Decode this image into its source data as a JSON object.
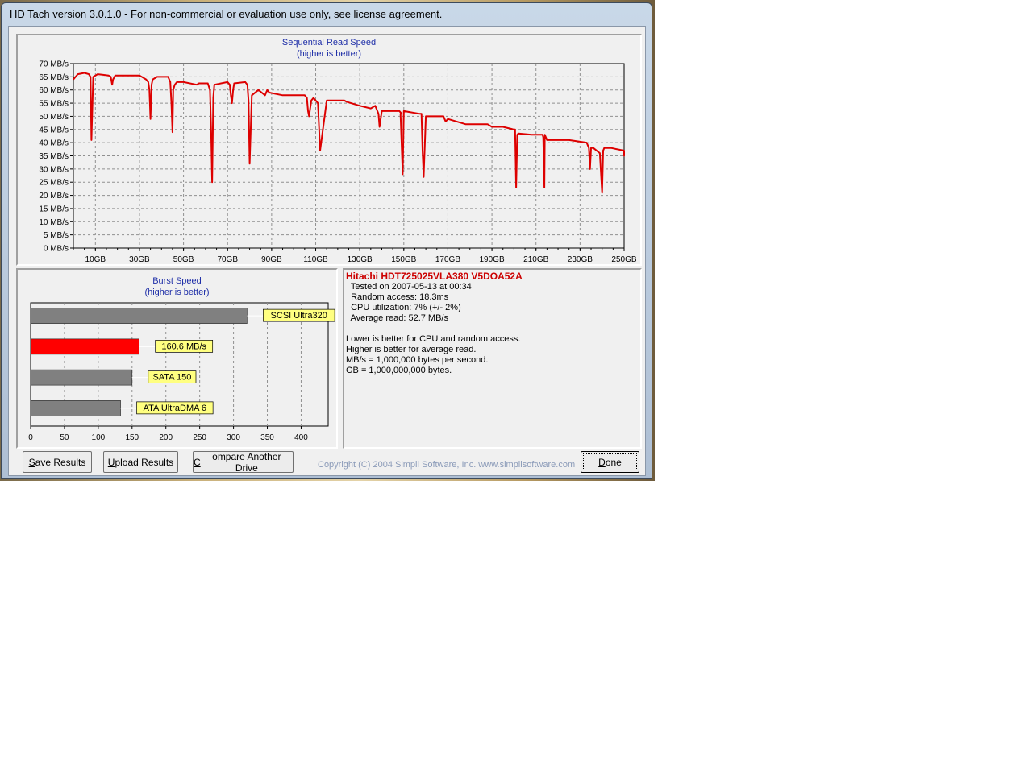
{
  "window": {
    "title": "HD Tach version 3.0.1.0  - For non-commercial or evaluation use only, see license agreement."
  },
  "colors": {
    "accent": "#dd0000",
    "title_blue": "#1f2fa8",
    "bar_gray": "#808080",
    "label_yellow": "#ffff80"
  },
  "sequential": {
    "title": "Sequential Read Speed",
    "subtitle": "(higher is better)"
  },
  "burst": {
    "title": "Burst Speed",
    "subtitle": "(higher is better)"
  },
  "chart_data": [
    {
      "type": "line",
      "title": "Sequential Read Speed",
      "subtitle": "(higher is better)",
      "xlabel": "",
      "ylabel": "",
      "x_unit": "GB",
      "y_unit": "MB/s",
      "xlim": [
        0,
        250
      ],
      "ylim": [
        0,
        70
      ],
      "grid": true,
      "x_ticks": [
        "10GB",
        "30GB",
        "50GB",
        "70GB",
        "90GB",
        "110GB",
        "130GB",
        "150GB",
        "170GB",
        "190GB",
        "210GB",
        "230GB",
        "250GB"
      ],
      "y_ticks": [
        "0 MB/s",
        "5 MB/s",
        "10 MB/s",
        "15 MB/s",
        "20 MB/s",
        "25 MB/s",
        "30 MB/s",
        "35 MB/s",
        "40 MB/s",
        "45 MB/s",
        "50 MB/s",
        "55 MB/s",
        "60 MB/s",
        "65 MB/s",
        "70 MB/s"
      ],
      "series": [
        {
          "color": "#dd0000",
          "x": [
            0,
            1,
            2,
            5,
            7,
            7.8,
            8.2,
            9,
            11,
            16,
            17,
            17.6,
            18,
            19,
            30,
            33,
            34,
            34.5,
            35,
            35.5,
            36,
            38,
            43,
            44,
            44.5,
            45,
            45.3,
            46,
            47,
            50,
            56,
            57,
            61,
            62,
            62.5,
            63,
            63.5,
            64,
            70,
            71,
            71.5,
            72,
            72.5,
            73,
            78,
            79,
            79.5,
            80,
            81,
            84,
            87,
            88,
            89,
            95,
            105,
            106,
            106.5,
            107,
            108,
            109,
            111,
            112,
            115,
            123,
            124,
            130,
            135,
            137,
            138.5,
            139,
            140,
            148,
            149,
            148.5,
            149.5,
            150,
            157,
            158,
            158.5,
            159,
            160,
            162,
            168,
            169,
            170,
            178,
            180,
            188,
            190,
            195,
            200,
            200.5,
            201,
            201.5,
            202,
            208,
            213,
            213.3,
            213.8,
            214,
            215,
            217,
            225,
            233,
            234,
            234.5,
            235,
            236,
            239,
            240,
            240.5,
            241,
            242,
            244,
            250,
            250.5,
            251
          ],
          "y": [
            64,
            65,
            66,
            66.5,
            66,
            65,
            41,
            65,
            66,
            65.5,
            65,
            62,
            64,
            65.5,
            65.5,
            64,
            63,
            60,
            49,
            62,
            64,
            65,
            65,
            63,
            55,
            44,
            60,
            62,
            63,
            63,
            62,
            62.5,
            62.5,
            60,
            45,
            25,
            57,
            62,
            63,
            62,
            58,
            55,
            60,
            62.5,
            63,
            62,
            56,
            32,
            58,
            60,
            58,
            60,
            59,
            58,
            58,
            57,
            52,
            50,
            56,
            57,
            55,
            37,
            56,
            56,
            55.5,
            54,
            53,
            54,
            51,
            46,
            52,
            52,
            51,
            51,
            28,
            52,
            51,
            51,
            37,
            27,
            50,
            50,
            50,
            48,
            49,
            47,
            47,
            47,
            46,
            46,
            45,
            45,
            23,
            43,
            43.5,
            43,
            43,
            42,
            23,
            43,
            41,
            41,
            41,
            40,
            38,
            30,
            38,
            38,
            36,
            21,
            37,
            38,
            38,
            38,
            37,
            35,
            36
          ],
          "annotations": []
        }
      ]
    },
    {
      "type": "bar",
      "orientation": "horizontal",
      "title": "Burst Speed",
      "subtitle": "(higher is better)",
      "xlim": [
        0,
        440
      ],
      "grid": true,
      "x_ticks": [
        "0",
        "50",
        "100",
        "150",
        "200",
        "250",
        "300",
        "350",
        "400"
      ],
      "categories": [
        "SCSI Ultra320",
        "160.6 MB/s",
        "SATA 150",
        "ATA UltraDMA 6"
      ],
      "values": [
        320,
        160.6,
        150,
        133
      ],
      "bar_colors": [
        "#808080",
        "#ff0000",
        "#808080",
        "#808080"
      ]
    }
  ],
  "info": {
    "drive": "Hitachi HDT725025VLA380 V5DOA52A",
    "tested": "  Tested on 2007-05-13 at 00:34",
    "random_access": "  Random access: 18.3ms",
    "cpu": "  CPU utilization: 7% (+/- 2%)",
    "average_read": "  Average read: 52.7 MB/s",
    "note1": "Lower is better for CPU and random access.",
    "note2": "Higher is better for average read.",
    "note3": "MB/s = 1,000,000 bytes per second.",
    "note4": "GB = 1,000,000,000 bytes."
  },
  "buttons": {
    "save": {
      "mnemonic": "S",
      "rest": "ave Results"
    },
    "upload": {
      "mnemonic": "U",
      "rest": "pload Results"
    },
    "compare": {
      "mnemonic": "C",
      "rest": "ompare Another Drive"
    },
    "done": {
      "mnemonic": "D",
      "rest": "one"
    }
  },
  "copyright": "Copyright (C) 2004 Simpli Software, Inc. www.simplisoftware.com"
}
